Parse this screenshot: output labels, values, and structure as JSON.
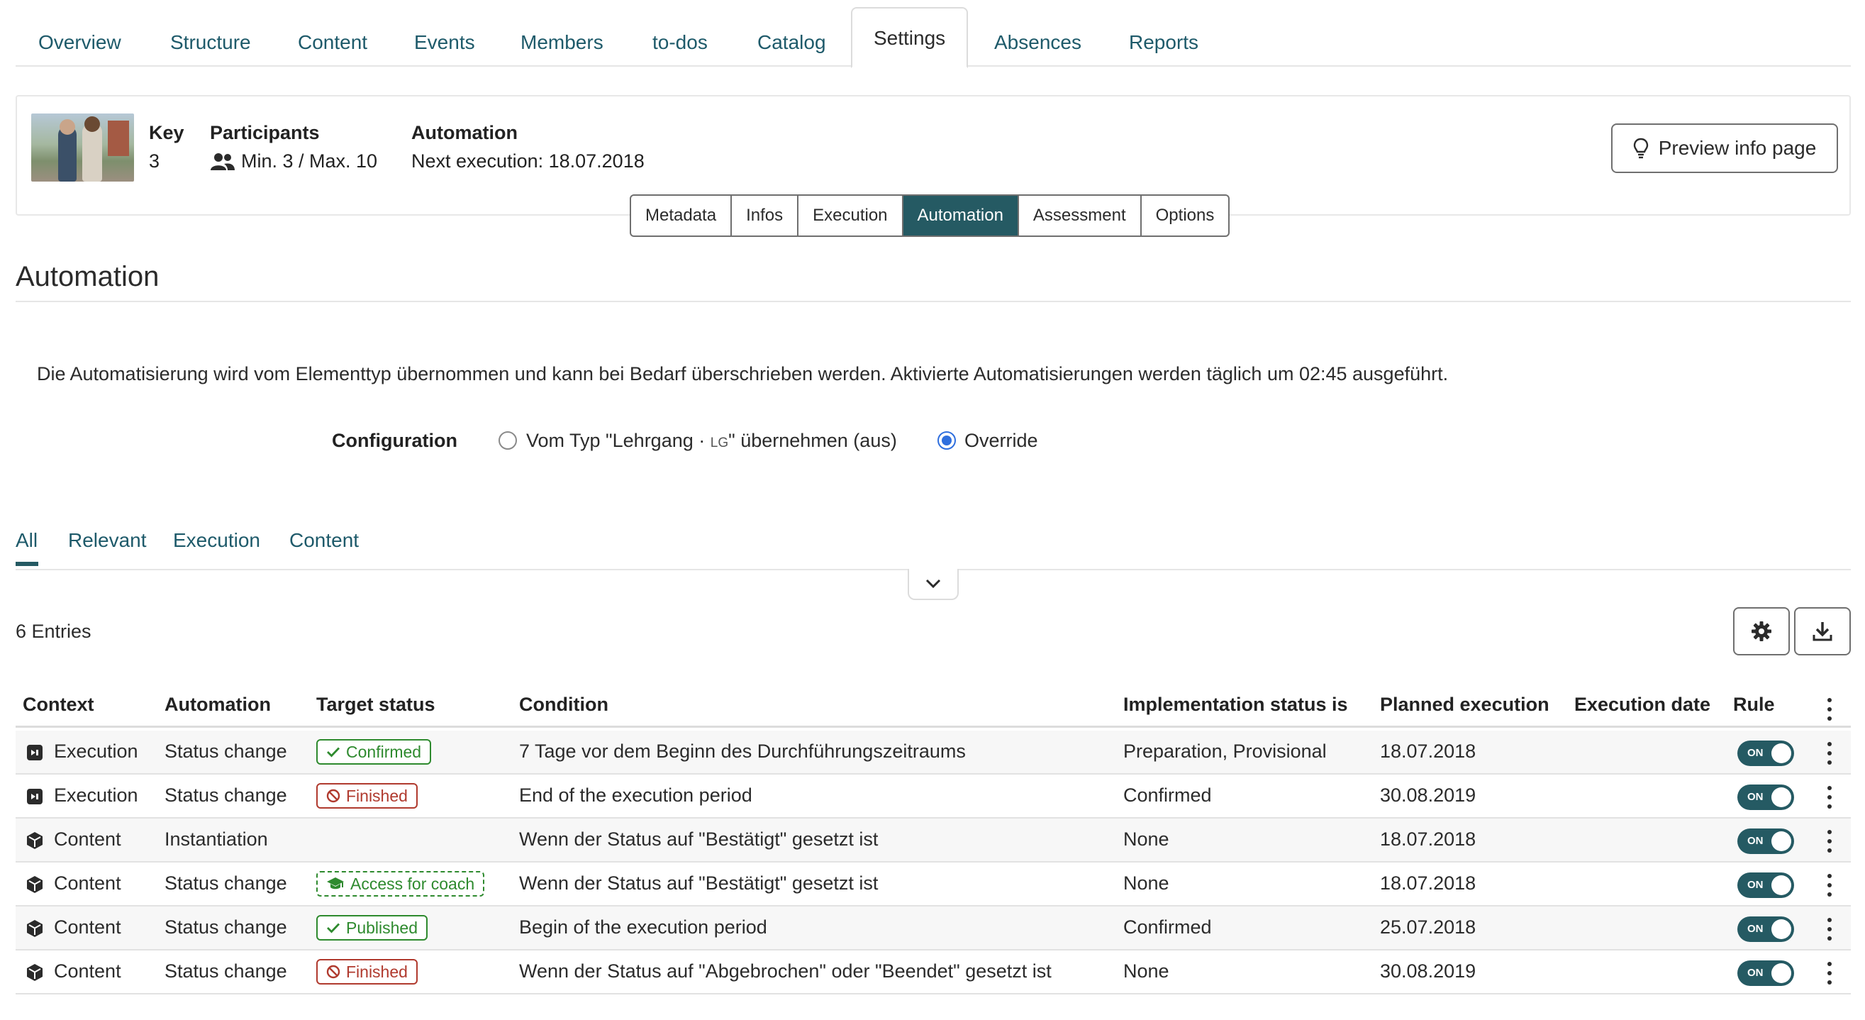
{
  "topnav": {
    "tabs": [
      {
        "label": "Overview"
      },
      {
        "label": "Structure"
      },
      {
        "label": "Content"
      },
      {
        "label": "Events"
      },
      {
        "label": "Members"
      },
      {
        "label": "to-dos"
      },
      {
        "label": "Catalog"
      },
      {
        "label": "Settings",
        "active": true
      },
      {
        "label": "Absences"
      },
      {
        "label": "Reports"
      }
    ]
  },
  "header": {
    "key_label": "Key",
    "key_value": "3",
    "participants_label": "Participants",
    "participants_value": "Min. 3 / Max. 10",
    "automation_label": "Automation",
    "automation_value": "Next execution: 18.07.2018",
    "preview_button": "Preview info page"
  },
  "subtabs": [
    "Metadata",
    "Infos",
    "Execution",
    "Automation",
    "Assessment",
    "Options"
  ],
  "subtabs_active": "Automation",
  "section": {
    "title": "Automation",
    "description": "Die Automatisierung wird vom Elementtyp übernommen und kann bei Bedarf überschrieben werden. Aktivierte Automatisierungen werden täglich um 02:45 ausgeführt."
  },
  "configuration": {
    "label": "Configuration",
    "option_inherit_prefix": "Vom Typ \"Lehrgang · ",
    "option_inherit_code": "LG",
    "option_inherit_suffix": "\" übernehmen (aus)",
    "option_override": "Override",
    "selected": "Override"
  },
  "filter_tabs": [
    "All",
    "Relevant",
    "Execution",
    "Content"
  ],
  "filter_active": "All",
  "table": {
    "entries_label": "6 Entries",
    "columns": [
      "Context",
      "Automation",
      "Target status",
      "Condition",
      "Implementation status is",
      "Planned execution",
      "Execution date",
      "Rule"
    ],
    "toggle_label": "ON",
    "rows": [
      {
        "context": "Execution",
        "context_icon": "execution-icon",
        "automation": "Status change",
        "target": "Confirmed",
        "target_style": "green",
        "target_icon": "check-icon",
        "condition": "7 Tage vor dem Beginn des Durchführungszeitraums",
        "impl": "Preparation, Provisional",
        "planned": "18.07.2018",
        "exec_date": "",
        "rule_on": true
      },
      {
        "context": "Execution",
        "context_icon": "execution-icon",
        "automation": "Status change",
        "target": "Finished",
        "target_style": "red",
        "target_icon": "ban-icon",
        "condition": "End of the execution period",
        "impl": "Confirmed",
        "planned": "30.08.2019",
        "exec_date": "",
        "rule_on": true
      },
      {
        "context": "Content",
        "context_icon": "cube-icon",
        "automation": "Instantiation",
        "target": "",
        "target_style": "",
        "target_icon": "",
        "condition": "Wenn der Status auf \"Bestätigt\" gesetzt ist",
        "impl": "None",
        "planned": "18.07.2018",
        "exec_date": "",
        "rule_on": true
      },
      {
        "context": "Content",
        "context_icon": "cube-icon",
        "automation": "Status change",
        "target": "Access for coach",
        "target_style": "dashed",
        "target_icon": "graduation-cap-icon",
        "condition": "Wenn der Status auf \"Bestätigt\" gesetzt ist",
        "impl": "None",
        "planned": "18.07.2018",
        "exec_date": "",
        "rule_on": true
      },
      {
        "context": "Content",
        "context_icon": "cube-icon",
        "automation": "Status change",
        "target": "Published",
        "target_style": "green",
        "target_icon": "check-icon",
        "condition": "Begin of the execution period",
        "impl": "Confirmed",
        "planned": "25.07.2018",
        "exec_date": "",
        "rule_on": true
      },
      {
        "context": "Content",
        "context_icon": "cube-icon",
        "automation": "Status change",
        "target": "Finished",
        "target_style": "red",
        "target_icon": "ban-icon",
        "condition": "Wenn der Status auf \"Abgebrochen\" oder \"Beendet\" gesetzt ist",
        "impl": "None",
        "planned": "30.08.2019",
        "exec_date": "",
        "rule_on": true
      }
    ]
  },
  "colors": {
    "accent": "#255a63",
    "link": "#1e5a6a",
    "radio": "#2f6fde",
    "badge_green": "#2e8a2e",
    "badge_red": "#b03a2e"
  }
}
